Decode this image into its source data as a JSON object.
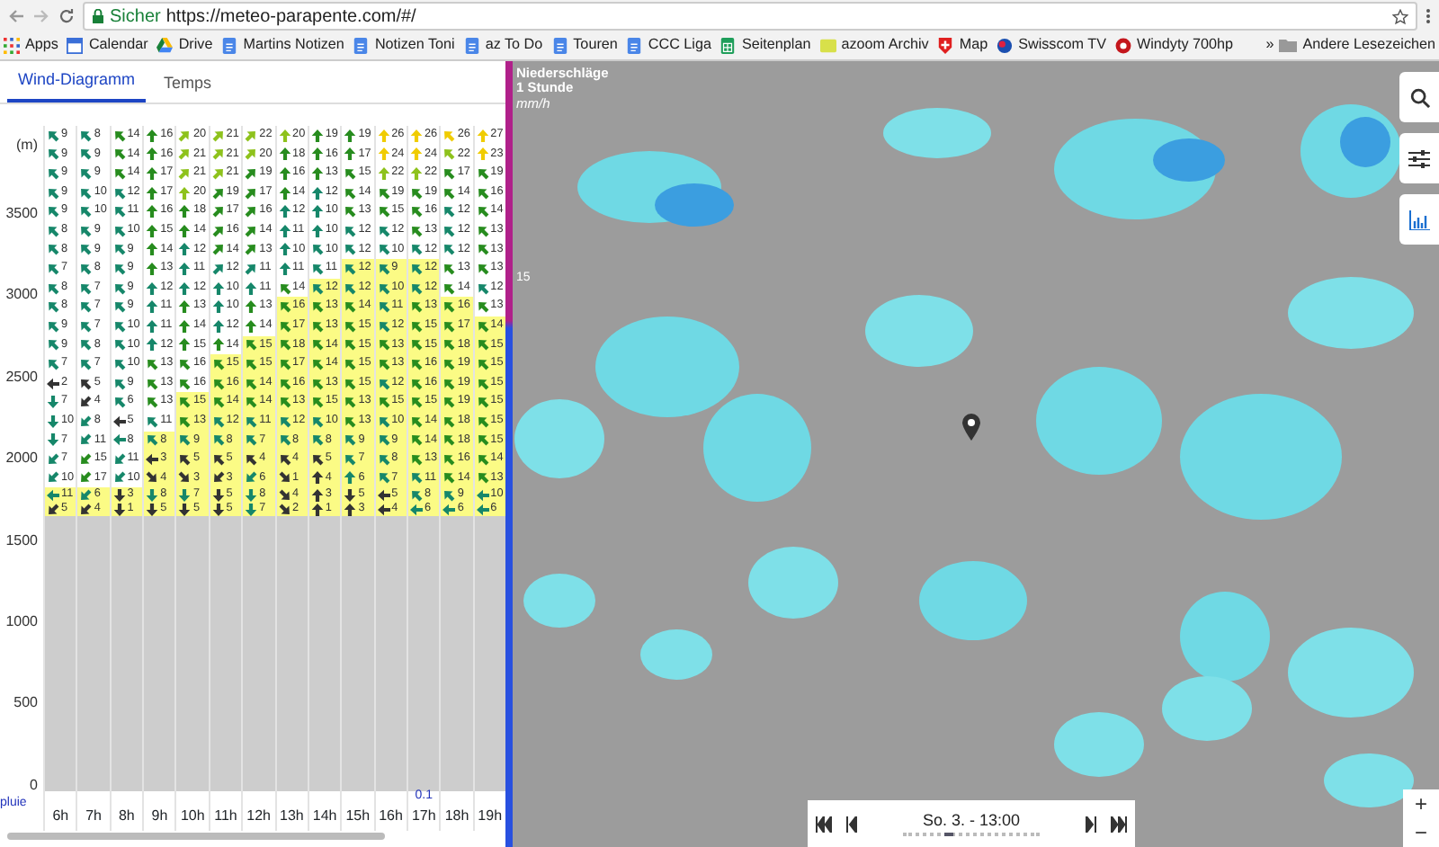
{
  "browser": {
    "secure_label": "Sicher",
    "url": "https://meteo-parapente.com/#/",
    "bookmarks": [
      {
        "label": "Apps",
        "kind": "apps"
      },
      {
        "label": "Calendar",
        "kind": "calendar"
      },
      {
        "label": "Drive",
        "kind": "drive"
      },
      {
        "label": "Martins Notizen",
        "kind": "doc"
      },
      {
        "label": "Notizen Toni",
        "kind": "doc"
      },
      {
        "label": "az To Do",
        "kind": "doc"
      },
      {
        "label": "Touren",
        "kind": "doc"
      },
      {
        "label": "CCC Liga",
        "kind": "doc"
      },
      {
        "label": "Seitenplan",
        "kind": "sheet"
      },
      {
        "label": "azoom Archiv",
        "kind": "azoom"
      },
      {
        "label": "Map",
        "kind": "flag"
      },
      {
        "label": "Swisscom TV",
        "kind": "swisscom"
      },
      {
        "label": "Windyty 700hp",
        "kind": "windy"
      }
    ],
    "overflow": "»",
    "other_bookmarks": "Andere Lesezeichen"
  },
  "tabs": [
    {
      "label": "Wind-Diagramm",
      "selected": true
    },
    {
      "label": "Temps",
      "selected": false
    }
  ],
  "wind_diagram": {
    "unit": "(m)",
    "altitude_ticks": [
      "3500",
      "3000",
      "2500",
      "2000",
      "1500",
      "1000",
      "500",
      "0"
    ],
    "rain_label": "pluie",
    "hours": [
      {
        "label": "6h"
      },
      {
        "label": "7h"
      },
      {
        "label": "8h"
      },
      {
        "label": "9h"
      },
      {
        "label": "10h"
      },
      {
        "label": "11h"
      },
      {
        "label": "12h"
      },
      {
        "label": "13h"
      },
      {
        "label": "14h"
      },
      {
        "label": "15h"
      },
      {
        "label": "16h"
      },
      {
        "label": "17h",
        "rain": "0.1"
      },
      {
        "label": "18h"
      },
      {
        "label": "19h"
      }
    ],
    "rows": [
      {
        "cells": [
          {
            "speed": "9",
            "kind": "nw",
            "highlighted": false
          },
          {
            "speed": "8",
            "kind": "nw",
            "highlighted": false
          },
          {
            "speed": "14",
            "kind": "nw",
            "highlighted": false
          },
          {
            "speed": "16",
            "kind": "n",
            "highlighted": false
          },
          {
            "speed": "20",
            "kind": "ne",
            "highlighted": false
          },
          {
            "speed": "21",
            "kind": "ne",
            "highlighted": false
          },
          {
            "speed": "22",
            "kind": "ne",
            "highlighted": false
          },
          {
            "speed": "20",
            "kind": "n",
            "highlighted": false
          },
          {
            "speed": "19",
            "kind": "n",
            "highlighted": false
          },
          {
            "speed": "19",
            "kind": "n",
            "highlighted": false
          },
          {
            "speed": "26",
            "kind": "n",
            "highlighted": false
          },
          {
            "speed": "26",
            "kind": "n",
            "highlighted": false
          },
          {
            "speed": "26",
            "kind": "nw",
            "highlighted": false
          },
          {
            "speed": "27",
            "kind": "n",
            "highlighted": false
          }
        ]
      },
      {
        "cells": [
          {
            "speed": "9",
            "kind": "nw",
            "highlighted": false
          },
          {
            "speed": "9",
            "kind": "nw",
            "highlighted": false
          },
          {
            "speed": "14",
            "kind": "nw",
            "highlighted": false
          },
          {
            "speed": "16",
            "kind": "n",
            "highlighted": false
          },
          {
            "speed": "21",
            "kind": "ne",
            "highlighted": false
          },
          {
            "speed": "21",
            "kind": "ne",
            "highlighted": false
          },
          {
            "speed": "20",
            "kind": "ne",
            "highlighted": false
          },
          {
            "speed": "18",
            "kind": "n",
            "highlighted": false
          },
          {
            "speed": "16",
            "kind": "n",
            "highlighted": false
          },
          {
            "speed": "17",
            "kind": "n",
            "highlighted": false
          },
          {
            "speed": "24",
            "kind": "n",
            "highlighted": false
          },
          {
            "speed": "24",
            "kind": "n",
            "highlighted": false
          },
          {
            "speed": "22",
            "kind": "nw",
            "highlighted": false
          },
          {
            "speed": "23",
            "kind": "n",
            "highlighted": false
          }
        ]
      },
      {
        "cells": [
          {
            "speed": "9",
            "kind": "nw",
            "highlighted": false
          },
          {
            "speed": "9",
            "kind": "nw",
            "highlighted": false
          },
          {
            "speed": "14",
            "kind": "nw",
            "highlighted": false
          },
          {
            "speed": "17",
            "kind": "n",
            "highlighted": false
          },
          {
            "speed": "21",
            "kind": "ne",
            "highlighted": false
          },
          {
            "speed": "21",
            "kind": "ne",
            "highlighted": false
          },
          {
            "speed": "19",
            "kind": "ne",
            "highlighted": false
          },
          {
            "speed": "16",
            "kind": "n",
            "highlighted": false
          },
          {
            "speed": "13",
            "kind": "n",
            "highlighted": false
          },
          {
            "speed": "15",
            "kind": "nw",
            "highlighted": false
          },
          {
            "speed": "22",
            "kind": "n",
            "highlighted": false
          },
          {
            "speed": "22",
            "kind": "n",
            "highlighted": false
          },
          {
            "speed": "17",
            "kind": "nw",
            "highlighted": false
          },
          {
            "speed": "19",
            "kind": "nw",
            "highlighted": false
          }
        ]
      },
      {
        "cells": [
          {
            "speed": "9",
            "kind": "nw",
            "highlighted": false
          },
          {
            "speed": "10",
            "kind": "nw",
            "highlighted": false
          },
          {
            "speed": "12",
            "kind": "nw",
            "highlighted": false
          },
          {
            "speed": "17",
            "kind": "n",
            "highlighted": false
          },
          {
            "speed": "20",
            "kind": "n",
            "highlighted": false
          },
          {
            "speed": "19",
            "kind": "ne",
            "highlighted": false
          },
          {
            "speed": "17",
            "kind": "ne",
            "highlighted": false
          },
          {
            "speed": "14",
            "kind": "n",
            "highlighted": false
          },
          {
            "speed": "12",
            "kind": "n",
            "highlighted": false
          },
          {
            "speed": "14",
            "kind": "nw",
            "highlighted": false
          },
          {
            "speed": "19",
            "kind": "nw",
            "highlighted": false
          },
          {
            "speed": "19",
            "kind": "nw",
            "highlighted": false
          },
          {
            "speed": "14",
            "kind": "nw",
            "highlighted": false
          },
          {
            "speed": "16",
            "kind": "nw",
            "highlighted": false
          }
        ]
      },
      {
        "cells": [
          {
            "speed": "9",
            "kind": "nw",
            "highlighted": false
          },
          {
            "speed": "10",
            "kind": "nw",
            "highlighted": false
          },
          {
            "speed": "11",
            "kind": "nw",
            "highlighted": false
          },
          {
            "speed": "16",
            "kind": "n",
            "highlighted": false
          },
          {
            "speed": "18",
            "kind": "n",
            "highlighted": false
          },
          {
            "speed": "17",
            "kind": "ne",
            "highlighted": false
          },
          {
            "speed": "16",
            "kind": "ne",
            "highlighted": false
          },
          {
            "speed": "12",
            "kind": "n",
            "highlighted": false
          },
          {
            "speed": "10",
            "kind": "n",
            "highlighted": false
          },
          {
            "speed": "13",
            "kind": "nw",
            "highlighted": false
          },
          {
            "speed": "15",
            "kind": "nw",
            "highlighted": false
          },
          {
            "speed": "16",
            "kind": "nw",
            "highlighted": false
          },
          {
            "speed": "12",
            "kind": "nw",
            "highlighted": false
          },
          {
            "speed": "14",
            "kind": "nw",
            "highlighted": false
          }
        ]
      },
      {
        "cells": [
          {
            "speed": "8",
            "kind": "nw",
            "highlighted": false
          },
          {
            "speed": "9",
            "kind": "nw",
            "highlighted": false
          },
          {
            "speed": "10",
            "kind": "nw",
            "highlighted": false
          },
          {
            "speed": "15",
            "kind": "n",
            "highlighted": false
          },
          {
            "speed": "14",
            "kind": "n",
            "highlighted": false
          },
          {
            "speed": "16",
            "kind": "ne",
            "highlighted": false
          },
          {
            "speed": "14",
            "kind": "ne",
            "highlighted": false
          },
          {
            "speed": "11",
            "kind": "n",
            "highlighted": false
          },
          {
            "speed": "10",
            "kind": "n",
            "highlighted": false
          },
          {
            "speed": "12",
            "kind": "nw",
            "highlighted": false
          },
          {
            "speed": "12",
            "kind": "nw",
            "highlighted": false
          },
          {
            "speed": "13",
            "kind": "nw",
            "highlighted": false
          },
          {
            "speed": "12",
            "kind": "nw",
            "highlighted": false
          },
          {
            "speed": "13",
            "kind": "nw",
            "highlighted": false
          }
        ]
      },
      {
        "cells": [
          {
            "speed": "8",
            "kind": "nw",
            "highlighted": false
          },
          {
            "speed": "9",
            "kind": "nw",
            "highlighted": false
          },
          {
            "speed": "9",
            "kind": "nw",
            "highlighted": false
          },
          {
            "speed": "14",
            "kind": "n",
            "highlighted": false
          },
          {
            "speed": "12",
            "kind": "n",
            "highlighted": false
          },
          {
            "speed": "14",
            "kind": "ne",
            "highlighted": false
          },
          {
            "speed": "13",
            "kind": "ne",
            "highlighted": false
          },
          {
            "speed": "10",
            "kind": "n",
            "highlighted": false
          },
          {
            "speed": "10",
            "kind": "nw",
            "highlighted": false
          },
          {
            "speed": "12",
            "kind": "nw",
            "highlighted": false
          },
          {
            "speed": "10",
            "kind": "nw",
            "highlighted": false
          },
          {
            "speed": "12",
            "kind": "nw",
            "highlighted": false
          },
          {
            "speed": "12",
            "kind": "nw",
            "highlighted": false
          },
          {
            "speed": "13",
            "kind": "nw",
            "highlighted": false
          }
        ]
      },
      {
        "cells": [
          {
            "speed": "7",
            "kind": "nw",
            "highlighted": false
          },
          {
            "speed": "8",
            "kind": "nw",
            "highlighted": false
          },
          {
            "speed": "9",
            "kind": "nw",
            "highlighted": false
          },
          {
            "speed": "13",
            "kind": "n",
            "highlighted": false
          },
          {
            "speed": "11",
            "kind": "n",
            "highlighted": false
          },
          {
            "speed": "12",
            "kind": "ne",
            "highlighted": false
          },
          {
            "speed": "11",
            "kind": "ne",
            "highlighted": false
          },
          {
            "speed": "11",
            "kind": "n",
            "highlighted": false
          },
          {
            "speed": "11",
            "kind": "nw",
            "highlighted": false
          },
          {
            "speed": "12",
            "kind": "nw",
            "highlighted": true
          },
          {
            "speed": "9",
            "kind": "nw",
            "highlighted": true
          },
          {
            "speed": "12",
            "kind": "nw",
            "highlighted": true
          },
          {
            "speed": "13",
            "kind": "nw",
            "highlighted": false
          },
          {
            "speed": "13",
            "kind": "nw",
            "highlighted": false
          }
        ]
      },
      {
        "cells": [
          {
            "speed": "8",
            "kind": "nw",
            "highlighted": false
          },
          {
            "speed": "7",
            "kind": "nw",
            "highlighted": false
          },
          {
            "speed": "9",
            "kind": "nw",
            "highlighted": false
          },
          {
            "speed": "12",
            "kind": "n",
            "highlighted": false
          },
          {
            "speed": "12",
            "kind": "n",
            "highlighted": false
          },
          {
            "speed": "10",
            "kind": "n",
            "highlighted": false
          },
          {
            "speed": "11",
            "kind": "n",
            "highlighted": false
          },
          {
            "speed": "14",
            "kind": "nw",
            "highlighted": false
          },
          {
            "speed": "12",
            "kind": "nw",
            "highlighted": true
          },
          {
            "speed": "12",
            "kind": "nw",
            "highlighted": true
          },
          {
            "speed": "10",
            "kind": "nw",
            "highlighted": true
          },
          {
            "speed": "12",
            "kind": "nw",
            "highlighted": true
          },
          {
            "speed": "14",
            "kind": "nw",
            "highlighted": false
          },
          {
            "speed": "12",
            "kind": "nw",
            "highlighted": false
          }
        ]
      },
      {
        "cells": [
          {
            "speed": "8",
            "kind": "nw",
            "highlighted": false
          },
          {
            "speed": "7",
            "kind": "nw",
            "highlighted": false
          },
          {
            "speed": "9",
            "kind": "nw",
            "highlighted": false
          },
          {
            "speed": "11",
            "kind": "n",
            "highlighted": false
          },
          {
            "speed": "13",
            "kind": "n",
            "highlighted": false
          },
          {
            "speed": "10",
            "kind": "n",
            "highlighted": false
          },
          {
            "speed": "13",
            "kind": "n",
            "highlighted": false
          },
          {
            "speed": "16",
            "kind": "nw",
            "highlighted": true
          },
          {
            "speed": "13",
            "kind": "nw",
            "highlighted": true
          },
          {
            "speed": "14",
            "kind": "nw",
            "highlighted": true
          },
          {
            "speed": "11",
            "kind": "nw",
            "highlighted": true
          },
          {
            "speed": "13",
            "kind": "nw",
            "highlighted": true
          },
          {
            "speed": "16",
            "kind": "nw",
            "highlighted": true
          },
          {
            "speed": "13",
            "kind": "nw",
            "highlighted": false
          }
        ]
      },
      {
        "cells": [
          {
            "speed": "9",
            "kind": "nw",
            "highlighted": false
          },
          {
            "speed": "7",
            "kind": "nw",
            "highlighted": false
          },
          {
            "speed": "10",
            "kind": "nw",
            "highlighted": false
          },
          {
            "speed": "11",
            "kind": "n",
            "highlighted": false
          },
          {
            "speed": "14",
            "kind": "n",
            "highlighted": false
          },
          {
            "speed": "12",
            "kind": "n",
            "highlighted": false
          },
          {
            "speed": "14",
            "kind": "n",
            "highlighted": false
          },
          {
            "speed": "17",
            "kind": "nw",
            "highlighted": true
          },
          {
            "speed": "13",
            "kind": "nw",
            "highlighted": true
          },
          {
            "speed": "15",
            "kind": "nw",
            "highlighted": true
          },
          {
            "speed": "12",
            "kind": "nw",
            "highlighted": true
          },
          {
            "speed": "15",
            "kind": "nw",
            "highlighted": true
          },
          {
            "speed": "17",
            "kind": "nw",
            "highlighted": true
          },
          {
            "speed": "14",
            "kind": "nw",
            "highlighted": true
          }
        ]
      },
      {
        "cells": [
          {
            "speed": "9",
            "kind": "nw",
            "highlighted": false
          },
          {
            "speed": "8",
            "kind": "nw",
            "highlighted": false
          },
          {
            "speed": "10",
            "kind": "nw",
            "highlighted": false
          },
          {
            "speed": "12",
            "kind": "n",
            "highlighted": false
          },
          {
            "speed": "15",
            "kind": "n",
            "highlighted": false
          },
          {
            "speed": "14",
            "kind": "n",
            "highlighted": false
          },
          {
            "speed": "15",
            "kind": "nw",
            "highlighted": true
          },
          {
            "speed": "18",
            "kind": "nw",
            "highlighted": true
          },
          {
            "speed": "14",
            "kind": "nw",
            "highlighted": true
          },
          {
            "speed": "15",
            "kind": "nw",
            "highlighted": true
          },
          {
            "speed": "13",
            "kind": "nw",
            "highlighted": true
          },
          {
            "speed": "15",
            "kind": "nw",
            "highlighted": true
          },
          {
            "speed": "18",
            "kind": "nw",
            "highlighted": true
          },
          {
            "speed": "15",
            "kind": "nw",
            "highlighted": true
          }
        ]
      },
      {
        "cells": [
          {
            "speed": "7",
            "kind": "nw",
            "highlighted": false
          },
          {
            "speed": "7",
            "kind": "nw",
            "highlighted": false
          },
          {
            "speed": "10",
            "kind": "nw",
            "highlighted": false
          },
          {
            "speed": "13",
            "kind": "nw",
            "highlighted": false
          },
          {
            "speed": "16",
            "kind": "nw",
            "highlighted": false
          },
          {
            "speed": "15",
            "kind": "nw",
            "highlighted": true
          },
          {
            "speed": "15",
            "kind": "nw",
            "highlighted": true
          },
          {
            "speed": "17",
            "kind": "nw",
            "highlighted": true
          },
          {
            "speed": "14",
            "kind": "nw",
            "highlighted": true
          },
          {
            "speed": "15",
            "kind": "nw",
            "highlighted": true
          },
          {
            "speed": "13",
            "kind": "nw",
            "highlighted": true
          },
          {
            "speed": "16",
            "kind": "nw",
            "highlighted": true
          },
          {
            "speed": "19",
            "kind": "nw",
            "highlighted": true
          },
          {
            "speed": "15",
            "kind": "nw",
            "highlighted": true
          }
        ]
      },
      {
        "cells": [
          {
            "speed": "2",
            "kind": "w",
            "highlighted": false
          },
          {
            "speed": "5",
            "kind": "nw",
            "highlighted": false
          },
          {
            "speed": "9",
            "kind": "nw",
            "highlighted": false
          },
          {
            "speed": "13",
            "kind": "nw",
            "highlighted": false
          },
          {
            "speed": "16",
            "kind": "nw",
            "highlighted": false
          },
          {
            "speed": "16",
            "kind": "nw",
            "highlighted": true
          },
          {
            "speed": "14",
            "kind": "nw",
            "highlighted": true
          },
          {
            "speed": "16",
            "kind": "nw",
            "highlighted": true
          },
          {
            "speed": "13",
            "kind": "nw",
            "highlighted": true
          },
          {
            "speed": "15",
            "kind": "nw",
            "highlighted": true
          },
          {
            "speed": "12",
            "kind": "nw",
            "highlighted": true
          },
          {
            "speed": "16",
            "kind": "nw",
            "highlighted": true
          },
          {
            "speed": "19",
            "kind": "nw",
            "highlighted": true
          },
          {
            "speed": "15",
            "kind": "nw",
            "highlighted": true
          }
        ]
      },
      {
        "cells": [
          {
            "speed": "7",
            "kind": "s",
            "highlighted": false
          },
          {
            "speed": "4",
            "kind": "sw",
            "highlighted": false
          },
          {
            "speed": "6",
            "kind": "nw",
            "highlighted": false
          },
          {
            "speed": "13",
            "kind": "nw",
            "highlighted": false
          },
          {
            "speed": "15",
            "kind": "nw",
            "highlighted": true
          },
          {
            "speed": "14",
            "kind": "nw",
            "highlighted": true
          },
          {
            "speed": "14",
            "kind": "nw",
            "highlighted": true
          },
          {
            "speed": "13",
            "kind": "nw",
            "highlighted": true
          },
          {
            "speed": "15",
            "kind": "nw",
            "highlighted": true
          },
          {
            "speed": "13",
            "kind": "nw",
            "highlighted": true
          },
          {
            "speed": "15",
            "kind": "nw",
            "highlighted": true
          },
          {
            "speed": "15",
            "kind": "nw",
            "highlighted": true
          },
          {
            "speed": "19",
            "kind": "nw",
            "highlighted": true
          },
          {
            "speed": "15",
            "kind": "nw",
            "highlighted": true
          }
        ]
      },
      {
        "cells": [
          {
            "speed": "10",
            "kind": "s",
            "highlighted": false
          },
          {
            "speed": "8",
            "kind": "sw",
            "highlighted": false
          },
          {
            "speed": "5",
            "kind": "w",
            "highlighted": false
          },
          {
            "speed": "11",
            "kind": "nw",
            "highlighted": false
          },
          {
            "speed": "13",
            "kind": "nw",
            "highlighted": true
          },
          {
            "speed": "12",
            "kind": "nw",
            "highlighted": true
          },
          {
            "speed": "11",
            "kind": "nw",
            "highlighted": true
          },
          {
            "speed": "12",
            "kind": "nw",
            "highlighted": true
          },
          {
            "speed": "10",
            "kind": "nw",
            "highlighted": true
          },
          {
            "speed": "13",
            "kind": "nw",
            "highlighted": true
          },
          {
            "speed": "10",
            "kind": "nw",
            "highlighted": true
          },
          {
            "speed": "14",
            "kind": "nw",
            "highlighted": true
          },
          {
            "speed": "18",
            "kind": "nw",
            "highlighted": true
          },
          {
            "speed": "15",
            "kind": "nw",
            "highlighted": true
          }
        ]
      },
      {
        "cells": [
          {
            "speed": "7",
            "kind": "s",
            "highlighted": false
          },
          {
            "speed": "11",
            "kind": "sw",
            "highlighted": false
          },
          {
            "speed": "8",
            "kind": "w",
            "highlighted": false
          },
          {
            "speed": "8",
            "kind": "nw",
            "highlighted": true
          },
          {
            "speed": "9",
            "kind": "nw",
            "highlighted": true
          },
          {
            "speed": "8",
            "kind": "nw",
            "highlighted": true
          },
          {
            "speed": "7",
            "kind": "nw",
            "highlighted": true
          },
          {
            "speed": "8",
            "kind": "nw",
            "highlighted": true
          },
          {
            "speed": "8",
            "kind": "nw",
            "highlighted": true
          },
          {
            "speed": "9",
            "kind": "nw",
            "highlighted": true
          },
          {
            "speed": "9",
            "kind": "nw",
            "highlighted": true
          },
          {
            "speed": "14",
            "kind": "nw",
            "highlighted": true
          },
          {
            "speed": "18",
            "kind": "nw",
            "highlighted": true
          },
          {
            "speed": "15",
            "kind": "nw",
            "highlighted": true
          }
        ]
      },
      {
        "cells": [
          {
            "speed": "7",
            "kind": "sw",
            "highlighted": false
          },
          {
            "speed": "15",
            "kind": "sw",
            "highlighted": false
          },
          {
            "speed": "11",
            "kind": "sw",
            "highlighted": false
          },
          {
            "speed": "3",
            "kind": "w",
            "highlighted": true
          },
          {
            "speed": "5",
            "kind": "nw",
            "highlighted": true
          },
          {
            "speed": "5",
            "kind": "nw",
            "highlighted": true
          },
          {
            "speed": "4",
            "kind": "nw",
            "highlighted": true
          },
          {
            "speed": "4",
            "kind": "nw",
            "highlighted": true
          },
          {
            "speed": "5",
            "kind": "nw",
            "highlighted": true
          },
          {
            "speed": "7",
            "kind": "nw",
            "highlighted": true
          },
          {
            "speed": "8",
            "kind": "nw",
            "highlighted": true
          },
          {
            "speed": "13",
            "kind": "nw",
            "highlighted": true
          },
          {
            "speed": "16",
            "kind": "nw",
            "highlighted": true
          },
          {
            "speed": "14",
            "kind": "nw",
            "highlighted": true
          }
        ]
      },
      {
        "cells": [
          {
            "speed": "10",
            "kind": "sw",
            "highlighted": false
          },
          {
            "speed": "17",
            "kind": "sw",
            "highlighted": false
          },
          {
            "speed": "10",
            "kind": "sw",
            "highlighted": false
          },
          {
            "speed": "4",
            "kind": "se",
            "highlighted": true
          },
          {
            "speed": "3",
            "kind": "se",
            "highlighted": true
          },
          {
            "speed": "3",
            "kind": "sw",
            "highlighted": true
          },
          {
            "speed": "6",
            "kind": "sw",
            "highlighted": true
          },
          {
            "speed": "1",
            "kind": "se",
            "highlighted": true
          },
          {
            "speed": "4",
            "kind": "n",
            "highlighted": true
          },
          {
            "speed": "6",
            "kind": "n",
            "highlighted": true
          },
          {
            "speed": "7",
            "kind": "nw",
            "highlighted": true
          },
          {
            "speed": "11",
            "kind": "nw",
            "highlighted": true
          },
          {
            "speed": "14",
            "kind": "nw",
            "highlighted": true
          },
          {
            "speed": "13",
            "kind": "nw",
            "highlighted": true
          }
        ]
      },
      {
        "cells": [
          {
            "speed": "11",
            "kind": "w",
            "highlighted": true
          },
          {
            "speed": "6",
            "kind": "sw",
            "highlighted": true
          },
          {
            "speed": "3",
            "kind": "s",
            "highlighted": true
          },
          {
            "speed": "8",
            "kind": "s",
            "highlighted": true
          },
          {
            "speed": "7",
            "kind": "s",
            "highlighted": true
          },
          {
            "speed": "5",
            "kind": "s",
            "highlighted": true
          },
          {
            "speed": "8",
            "kind": "s",
            "highlighted": true
          },
          {
            "speed": "4",
            "kind": "se",
            "highlighted": true
          },
          {
            "speed": "3",
            "kind": "n",
            "highlighted": true
          },
          {
            "speed": "5",
            "kind": "s",
            "highlighted": true
          },
          {
            "speed": "5",
            "kind": "w",
            "highlighted": true
          },
          {
            "speed": "8",
            "kind": "nw",
            "highlighted": true
          },
          {
            "speed": "9",
            "kind": "nw",
            "highlighted": true
          },
          {
            "speed": "10",
            "kind": "w",
            "highlighted": true
          }
        ]
      },
      {
        "cells": [
          {
            "speed": "5",
            "kind": "sw",
            "highlighted": true
          },
          {
            "speed": "4",
            "kind": "sw",
            "highlighted": true
          },
          {
            "speed": "1",
            "kind": "s",
            "highlighted": true
          },
          {
            "speed": "5",
            "kind": "s",
            "highlighted": true
          },
          {
            "speed": "5",
            "kind": "s",
            "highlighted": true
          },
          {
            "speed": "5",
            "kind": "s",
            "highlighted": true
          },
          {
            "speed": "7",
            "kind": "s",
            "highlighted": true
          },
          {
            "speed": "2",
            "kind": "se",
            "highlighted": true
          },
          {
            "speed": "1",
            "kind": "n",
            "highlighted": true
          },
          {
            "speed": "3",
            "kind": "n",
            "highlighted": true
          },
          {
            "speed": "4",
            "kind": "w",
            "highlighted": true
          },
          {
            "speed": "6",
            "kind": "w",
            "highlighted": true
          },
          {
            "speed": "6",
            "kind": "w",
            "highlighted": true
          },
          {
            "speed": "6",
            "kind": "w",
            "highlighted": true
          }
        ]
      }
    ]
  },
  "map": {
    "legend": {
      "title": "Niederschläge",
      "subtitle": "1 Stunde",
      "unit": "mm/h",
      "scale_label": "15"
    },
    "time_control": {
      "label": "So. 3. - 13:00",
      "level": 0.3
    },
    "zoom_in": "+",
    "zoom_out": "−"
  }
}
